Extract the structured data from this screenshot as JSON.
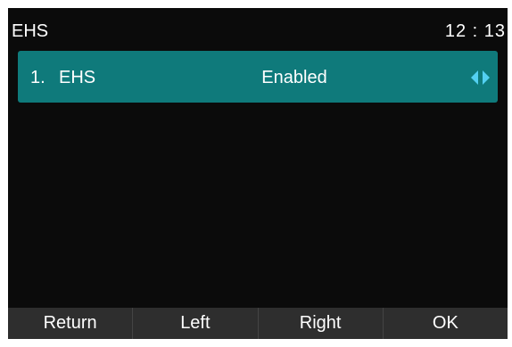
{
  "header": {
    "title": "EHS",
    "time": "12 : 13"
  },
  "menu": {
    "items": [
      {
        "index": "1.",
        "label": "EHS",
        "value": "Enabled"
      }
    ]
  },
  "softkeys": [
    {
      "label": "Return"
    },
    {
      "label": "Left"
    },
    {
      "label": "Right"
    },
    {
      "label": "OK"
    }
  ],
  "colors": {
    "screen_background": "#0b0b0b",
    "selected_row": "#0f7a7b",
    "arrow": "#53d0f2",
    "softkey_bar": "#2e2e2e"
  },
  "icons": {
    "value_left": "triangle-left-icon",
    "value_right": "triangle-right-icon"
  }
}
